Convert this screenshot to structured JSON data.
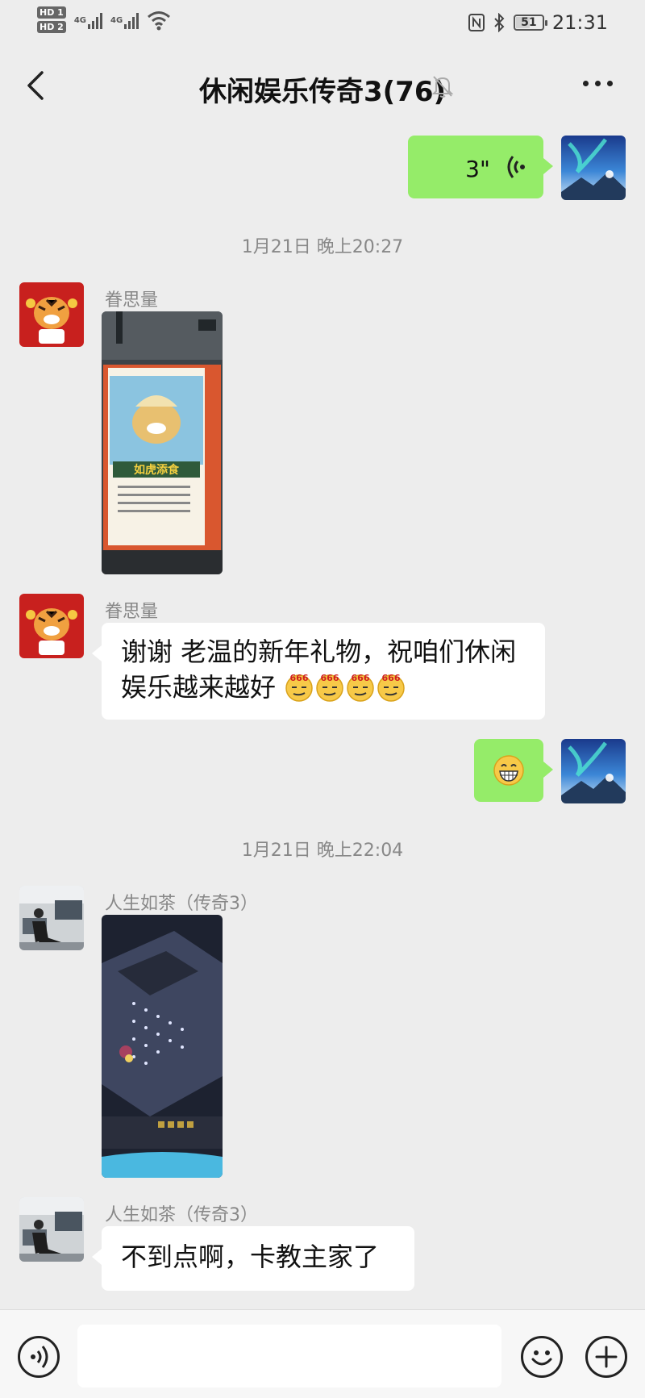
{
  "status_bar": {
    "hd1": "HD 1",
    "hd2": "HD 2",
    "net1": "4G",
    "net2": "4G",
    "battery": "51",
    "time": "21:31"
  },
  "header": {
    "title": "休闲娱乐传奇3(76)",
    "back_icon": "chevron-left-icon",
    "mute_icon": "bell-off-icon",
    "more_icon": "more-dots-icon"
  },
  "messages": {
    "voice": {
      "duration": "3\""
    },
    "ts1": "1月21日 晚上20:27",
    "m1_sender": "眷思量",
    "m2_sender": "眷思量",
    "m2_text": "谢谢  老温的新年礼物，祝咱们休闲娱乐越来越好",
    "m2_emoji_caption": "666",
    "ts2": "1月21日 晚上22:04",
    "m3_sender": "人生如茶（传奇3）",
    "m4_sender": "人生如茶（传奇3）",
    "m4_text": "不到点啊，卡教主家了",
    "calendar_caption": "如虎添食"
  },
  "colors": {
    "bg": "#ededed",
    "outgoing": "#95ec69",
    "incoming": "#ffffff"
  }
}
